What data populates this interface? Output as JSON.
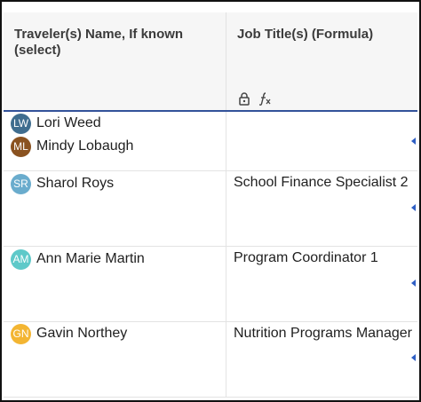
{
  "columns": [
    {
      "title": "Traveler(s) Name, If known (select)"
    },
    {
      "title": "Job Title(s) (Formula)",
      "icons": [
        "lock-icon",
        "formula-icon"
      ]
    }
  ],
  "rows": [
    {
      "people": [
        {
          "initials": "LW",
          "name": "Lori Weed",
          "color": "#3f6d8f"
        },
        {
          "initials": "ML",
          "name": "Mindy Lobaugh",
          "color": "#8a5220"
        }
      ],
      "job": ""
    },
    {
      "people": [
        {
          "initials": "SR",
          "name": "Sharol Roys",
          "color": "#6aaccd"
        }
      ],
      "job": "School Finance Specialist 2"
    },
    {
      "people": [
        {
          "initials": "AM",
          "name": "Ann Marie Martin",
          "color": "#5ec9c9"
        }
      ],
      "job": "Program Coordinator 1"
    },
    {
      "people": [
        {
          "initials": "GN",
          "name": "Gavin Northey",
          "color": "#f3b532"
        }
      ],
      "job": "Nutrition Programs Manager"
    }
  ],
  "colors": {
    "header_rule": "#33529a",
    "row_marker": "#2f5fc4",
    "header_bg": "#f6f6f6"
  }
}
